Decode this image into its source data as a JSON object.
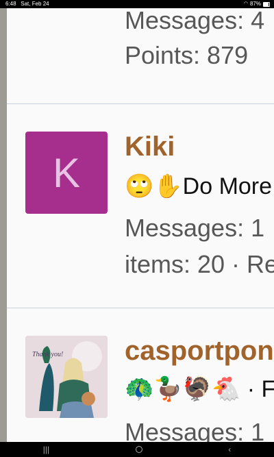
{
  "status_bar": {
    "time": "6:48",
    "date": "Sat, Feb 24",
    "battery": "87%",
    "battery_level": 0.87
  },
  "posts": [
    {
      "messages": "Messages: 4",
      "points": "Points: 879"
    },
    {
      "avatar_letter": "K",
      "avatar_color": "#a62e8c",
      "name": "Kiki",
      "emoji_text": "🙄✋Do More",
      "messages": "Messages: 1",
      "items": "items: 20 · Re"
    },
    {
      "name": "casportpon",
      "emoji_text": "🦚🦆🦃🐔 · F",
      "messages": "Messages: 1"
    }
  ],
  "navbar": {
    "recents_glyph": "|||",
    "back_glyph": "‹"
  },
  "colors": {
    "name": "#a0632c",
    "divider": "#c8d0da"
  }
}
